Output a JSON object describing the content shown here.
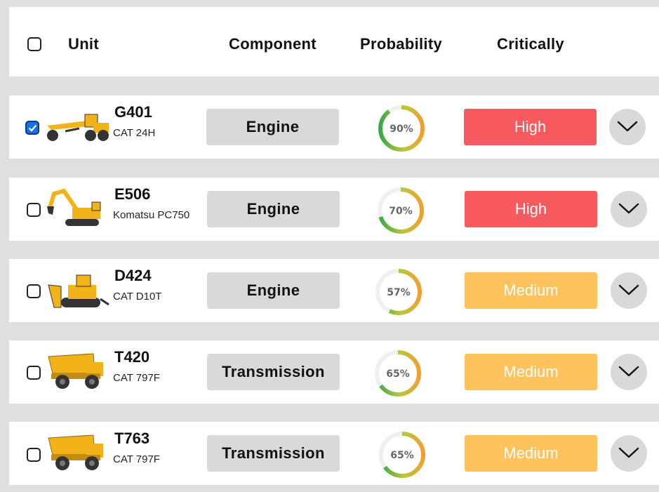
{
  "header": {
    "unit_label": "Unit",
    "component_label": "Component",
    "probability_label": "Probability",
    "criticality_label": "Critically"
  },
  "colors": {
    "high": "#f75a5e",
    "medium": "#ffc35d",
    "checkbox_checked": "#1c6fe0",
    "gauge_green": "#3aa84a",
    "gauge_orange": "#f0a030"
  },
  "rows": [
    {
      "checked": true,
      "icon": "motor-grader-icon",
      "code": "G401",
      "model": "CAT 24H",
      "component": "Engine",
      "probability": 0.9,
      "probability_text": "90%",
      "criticality": "High"
    },
    {
      "checked": false,
      "icon": "excavator-icon",
      "code": "E506",
      "model": "Komatsu PC750",
      "component": "Engine",
      "probability": 0.7,
      "probability_text": "70%",
      "criticality": "High"
    },
    {
      "checked": false,
      "icon": "dozer-icon",
      "code": "D424",
      "model": "CAT D10T",
      "component": "Engine",
      "probability": 0.57,
      "probability_text": "57%",
      "criticality": "Medium"
    },
    {
      "checked": false,
      "icon": "haul-truck-icon",
      "code": "T420",
      "model": "CAT 797F",
      "component": "Transmission",
      "probability": 0.65,
      "probability_text": "65%",
      "criticality": "Medium"
    },
    {
      "checked": false,
      "icon": "haul-truck-icon",
      "code": "T763",
      "model": "CAT 797F",
      "component": "Transmission",
      "probability": 0.65,
      "probability_text": "65%",
      "criticality": "Medium"
    }
  ]
}
